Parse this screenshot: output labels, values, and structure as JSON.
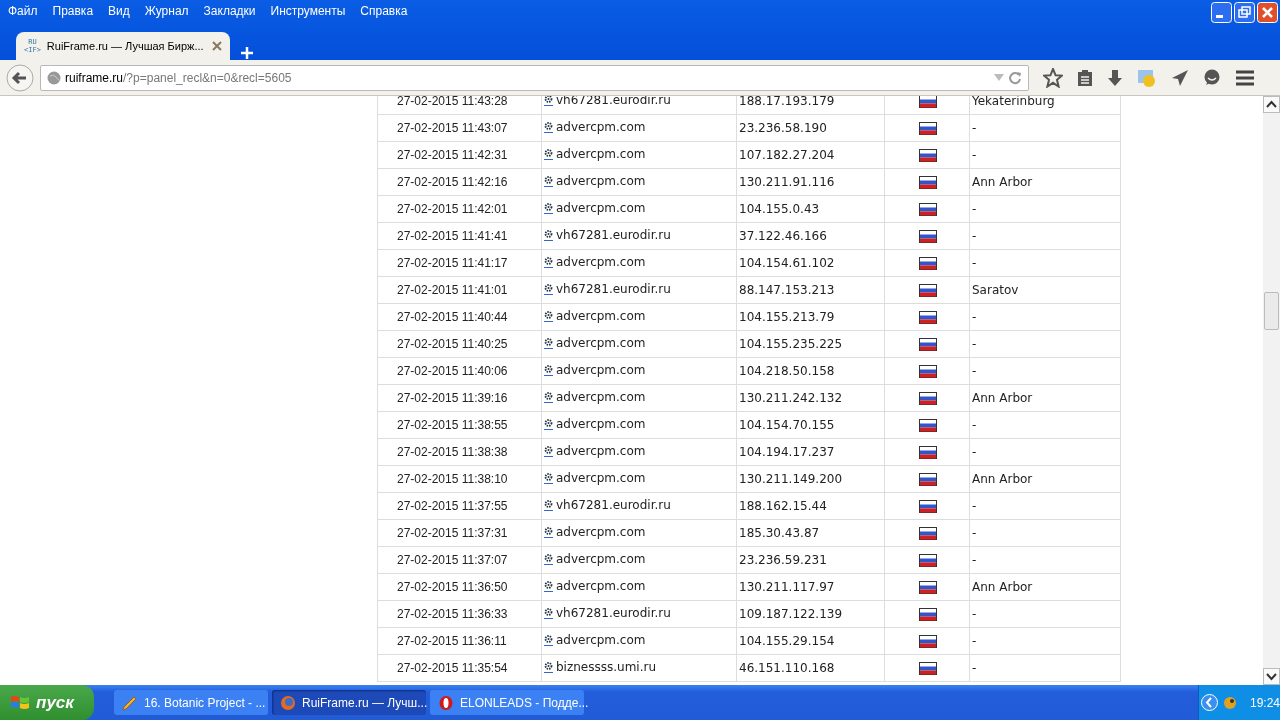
{
  "menu": [
    "Файл",
    "Правка",
    "Вид",
    "Журнал",
    "Закладки",
    "Инструменты",
    "Справка"
  ],
  "tab": {
    "favicon_top": "RU",
    "favicon_bottom": "<IF>",
    "title": "RuiFrame.ru — Лучшая Бирж...",
    "selected": true
  },
  "address": {
    "domain": "ruiframe.ru",
    "path": "/?p=panel_recl&n=0&recl=5605"
  },
  "rows": [
    {
      "time": "27-02-2015 11:43:28",
      "site": "vh67281.eurodir.ru",
      "ip": "188.17.193.179",
      "city": "Yekaterinburg"
    },
    {
      "time": "27-02-2015 11:43:07",
      "site": "advercpm.com",
      "ip": "23.236.58.190",
      "city": "-"
    },
    {
      "time": "27-02-2015 11:42:31",
      "site": "advercpm.com",
      "ip": "107.182.27.204",
      "city": "-"
    },
    {
      "time": "27-02-2015 11:42:16",
      "site": "advercpm.com",
      "ip": "130.211.91.116",
      "city": "Ann Arbor"
    },
    {
      "time": "27-02-2015 11:42:01",
      "site": "advercpm.com",
      "ip": "104.155.0.43",
      "city": "-"
    },
    {
      "time": "27-02-2015 11:41:41",
      "site": "vh67281.eurodir.ru",
      "ip": "37.122.46.166",
      "city": "-"
    },
    {
      "time": "27-02-2015 11:41:17",
      "site": "advercpm.com",
      "ip": "104.154.61.102",
      "city": "-"
    },
    {
      "time": "27-02-2015 11:41:01",
      "site": "vh67281.eurodir.ru",
      "ip": "88.147.153.213",
      "city": "Saratov"
    },
    {
      "time": "27-02-2015 11:40:44",
      "site": "advercpm.com",
      "ip": "104.155.213.79",
      "city": "-"
    },
    {
      "time": "27-02-2015 11:40:25",
      "site": "advercpm.com",
      "ip": "104.155.235.225",
      "city": "-"
    },
    {
      "time": "27-02-2015 11:40:06",
      "site": "advercpm.com",
      "ip": "104.218.50.158",
      "city": "-"
    },
    {
      "time": "27-02-2015 11:39:16",
      "site": "advercpm.com",
      "ip": "130.211.242.132",
      "city": "Ann Arbor"
    },
    {
      "time": "27-02-2015 11:38:55",
      "site": "advercpm.com",
      "ip": "104.154.70.155",
      "city": "-"
    },
    {
      "time": "27-02-2015 11:38:38",
      "site": "advercpm.com",
      "ip": "104.194.17.237",
      "city": "-"
    },
    {
      "time": "27-02-2015 11:38:10",
      "site": "advercpm.com",
      "ip": "130.211.149.200",
      "city": "Ann Arbor"
    },
    {
      "time": "27-02-2015 11:37:55",
      "site": "vh67281.eurodir.ru",
      "ip": "188.162.15.44",
      "city": "-"
    },
    {
      "time": "27-02-2015 11:37:31",
      "site": "advercpm.com",
      "ip": "185.30.43.87",
      "city": "-"
    },
    {
      "time": "27-02-2015 11:37:07",
      "site": "advercpm.com",
      "ip": "23.236.59.231",
      "city": "-"
    },
    {
      "time": "27-02-2015 11:36:50",
      "site": "advercpm.com",
      "ip": "130.211.117.97",
      "city": "Ann Arbor"
    },
    {
      "time": "27-02-2015 11:36:33",
      "site": "vh67281.eurodir.ru",
      "ip": "109.187.122.139",
      "city": "-"
    },
    {
      "time": "27-02-2015 11:36:11",
      "site": "advercpm.com",
      "ip": "104.155.29.154",
      "city": "-"
    },
    {
      "time": "27-02-2015 11:35:54",
      "site": "biznessss.umi.ru",
      "ip": "46.151.110.168",
      "city": "-"
    }
  ],
  "taskbar": {
    "start": "пуск",
    "items": [
      {
        "kind": "editor",
        "label": "16. Botanic Project - ...",
        "selected": false
      },
      {
        "kind": "firefox",
        "label": "RuiFrame.ru — Лучш...",
        "selected": true
      },
      {
        "kind": "opera",
        "label": "ELONLEADS - Подде...",
        "selected": false
      }
    ],
    "clock": "19:24"
  }
}
